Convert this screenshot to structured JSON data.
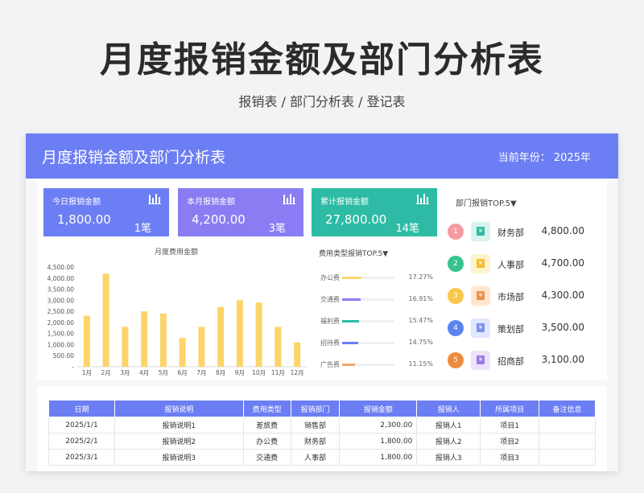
{
  "page": {
    "title": "月度报销金额及部门分析表",
    "subtitle": "报销表 / 部门分析表 / 登记表"
  },
  "banner": {
    "title": "月度报销金额及部门分析表",
    "year": "当前年份：  2025年"
  },
  "cards": [
    {
      "label": "今日报销金额",
      "value": "1,800.00",
      "count": "1笔",
      "color": "#6c7ef3",
      "icon": "bar-chart-icon"
    },
    {
      "label": "本月报销金额",
      "value": "4,200.00",
      "count": "3笔",
      "color": "#8a7cf2",
      "icon": "bar-chart-icon"
    },
    {
      "label": "累计报销金额",
      "value": "27,800.00",
      "count": "14笔",
      "color": "#2dbba5",
      "icon": "bar-chart-icon"
    }
  ],
  "chart_data": {
    "type": "bar",
    "title": "月度费用金额",
    "categories": [
      "1月",
      "2月",
      "3月",
      "4月",
      "5月",
      "6月",
      "7月",
      "8月",
      "9月",
      "10月",
      "11月",
      "12月"
    ],
    "values": [
      2300,
      4200,
      1800,
      2500,
      2400,
      1300,
      1800,
      2700,
      3000,
      2900,
      1800,
      1100
    ],
    "yticks": [
      "4,500.00",
      "4,000.00",
      "3,500.00",
      "3,000.00",
      "2,500.00",
      "2,000.00",
      "1,500.00",
      "1,000.00",
      "500.00",
      "-"
    ],
    "ylim": [
      0,
      4500
    ],
    "grid": false,
    "bar_color": "#fcd469"
  },
  "expense_top": {
    "title": "费用类型报销TOP.5▼",
    "items": [
      {
        "name": "办公费",
        "pct": "17.27%",
        "ratio": 0.37,
        "color": "#fcd469"
      },
      {
        "name": "交通费",
        "pct": "16.91%",
        "ratio": 0.36,
        "color": "#8a7cf2"
      },
      {
        "name": "福利费",
        "pct": "15.47%",
        "ratio": 0.33,
        "color": "#2dbba5"
      },
      {
        "name": "招待费",
        "pct": "14.75%",
        "ratio": 0.31,
        "color": "#6c7ef3"
      },
      {
        "name": "广告费",
        "pct": "11.15%",
        "ratio": 0.24,
        "color": "#f0a56b"
      }
    ]
  },
  "dept_top": {
    "title": "部门报销TOP.5▼",
    "items": [
      {
        "rank": "1",
        "name": "财务部",
        "amount": "4,800.00",
        "color": "#f59aa0",
        "icon_bg": "#d9f3ee",
        "icon_fg": "#2dbba5"
      },
      {
        "rank": "2",
        "name": "人事部",
        "amount": "4,700.00",
        "color": "#35c48d",
        "icon_bg": "#fdf3cf",
        "icon_fg": "#f3bd2e"
      },
      {
        "rank": "3",
        "name": "市场部",
        "amount": "4,300.00",
        "color": "#f8c84a",
        "icon_bg": "#fde6d2",
        "icon_fg": "#ef9048"
      },
      {
        "rank": "4",
        "name": "策划部",
        "amount": "3,500.00",
        "color": "#5b83f0",
        "icon_bg": "#e1e7fd",
        "icon_fg": "#7d92f0"
      },
      {
        "rank": "5",
        "name": "招商部",
        "amount": "3,100.00",
        "color": "#ef8a3c",
        "icon_bg": "#ece4fb",
        "icon_fg": "#9a7be6"
      }
    ]
  },
  "table": {
    "headers": [
      "日期",
      "报销说明",
      "费用类型",
      "报销部门",
      "报销金额",
      "报销人",
      "所属项目",
      "备注信息"
    ],
    "rows": [
      [
        "2025/1/1",
        "报销说明1",
        "差旅费",
        "销售部",
        "2,300.00",
        "报销人1",
        "项目1",
        ""
      ],
      [
        "2025/2/1",
        "报销说明2",
        "办公费",
        "财务部",
        "1,800.00",
        "报销人2",
        "项目2",
        ""
      ],
      [
        "2025/3/1",
        "报销说明3",
        "交通费",
        "人事部",
        "1,800.00",
        "报销人3",
        "项目3",
        ""
      ]
    ]
  }
}
